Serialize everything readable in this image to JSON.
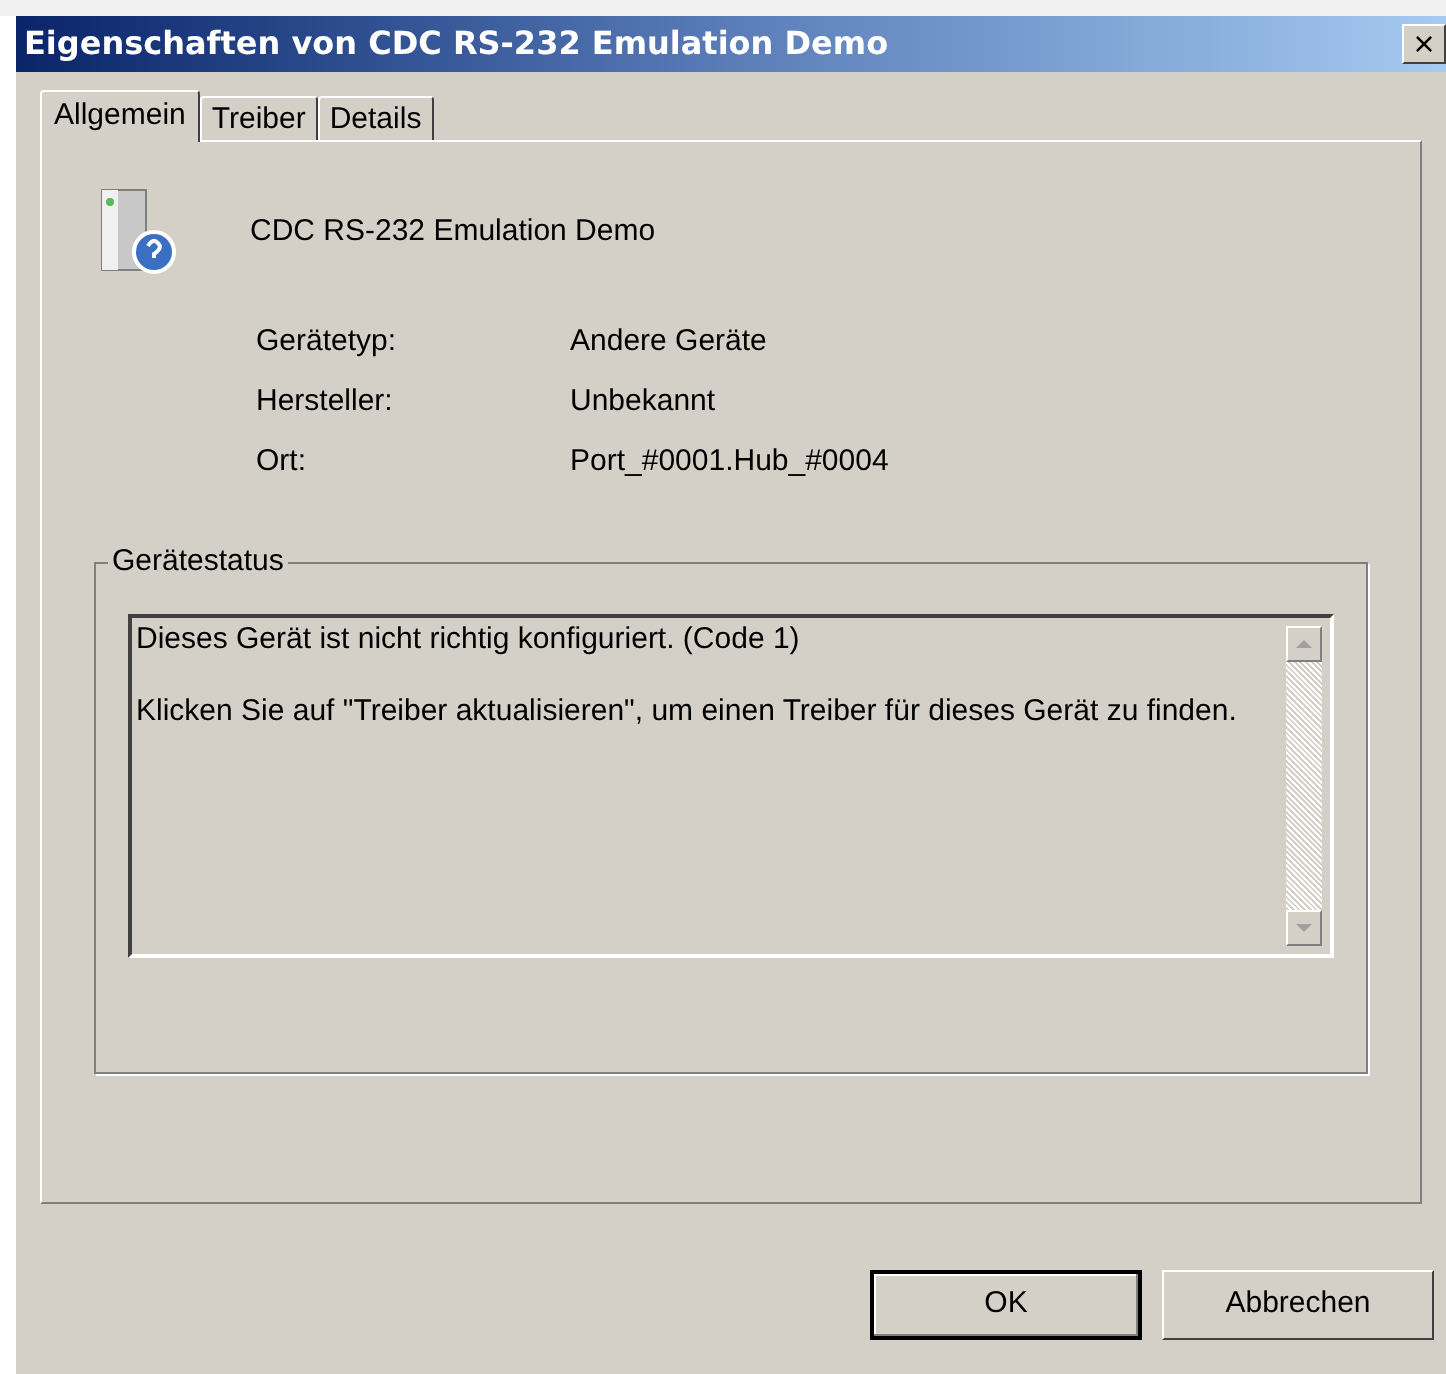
{
  "window": {
    "title": "Eigenschaften von CDC RS-232 Emulation Demo",
    "close": "×"
  },
  "tabs": [
    {
      "label": "Allgemein",
      "selected": true
    },
    {
      "label": "Treiber",
      "selected": false
    },
    {
      "label": "Details",
      "selected": false
    }
  ],
  "device": {
    "name": "CDC RS-232 Emulation Demo"
  },
  "properties": [
    {
      "label": "Gerätetyp:",
      "value": "Andere Geräte"
    },
    {
      "label": "Hersteller:",
      "value": "Unbekannt"
    },
    {
      "label": "Ort:",
      "value": "Port_#0001.Hub_#0004"
    }
  ],
  "status_group": {
    "title": "Gerätestatus",
    "lines": [
      "Dieses Gerät ist nicht richtig konfiguriert. (Code 1)",
      "Klicken Sie auf \"Treiber aktualisieren\", um einen Treiber für dieses Gerät zu finden."
    ]
  },
  "buttons": [
    {
      "label": "OK",
      "default": true
    },
    {
      "label": "Abbrechen",
      "default": false
    }
  ]
}
